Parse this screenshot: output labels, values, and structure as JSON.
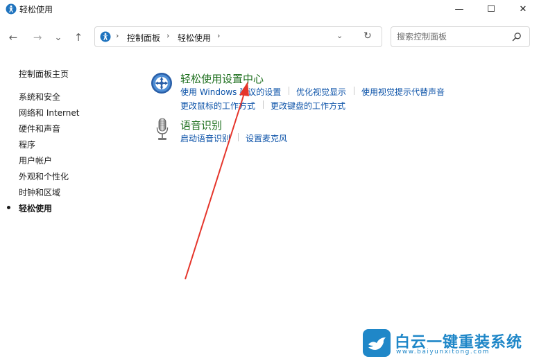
{
  "window": {
    "title": "轻松使用",
    "minimize_glyph": "—",
    "maximize_glyph": "☐",
    "close_glyph": "✕"
  },
  "nav": {
    "back_glyph": "←",
    "forward_glyph": "→",
    "recent_glyph": "⌄",
    "up_glyph": "↑",
    "breadcrumb": [
      "控制面板",
      "轻松使用"
    ],
    "dropdown_glyph": "⌄",
    "refresh_glyph": "↻"
  },
  "search": {
    "placeholder": "搜索控制面板"
  },
  "sidebar": {
    "items": [
      {
        "label": "控制面板主页",
        "current": false
      },
      {
        "label": "系统和安全",
        "current": false
      },
      {
        "label": "网络和 Internet",
        "current": false
      },
      {
        "label": "硬件和声音",
        "current": false
      },
      {
        "label": "程序",
        "current": false
      },
      {
        "label": "用户帐户",
        "current": false
      },
      {
        "label": "外观和个性化",
        "current": false
      },
      {
        "label": "时钟和区域",
        "current": false
      },
      {
        "label": "轻松使用",
        "current": true
      }
    ]
  },
  "main": {
    "sections": [
      {
        "title": "轻松使用设置中心",
        "icon": "ease-of-access-center-icon",
        "links": [
          "使用 Windows 建议的设置",
          "优化视觉显示",
          "使用视觉提示代替声音",
          "更改鼠标的工作方式",
          "更改键盘的工作方式"
        ]
      },
      {
        "title": "语音识别",
        "icon": "microphone-icon",
        "links": [
          "启动语音识别",
          "设置麦克风"
        ]
      }
    ]
  },
  "watermark": {
    "text": "白云一键重装系统",
    "url": "www.baiyunxitong.com"
  },
  "colors": {
    "section_title": "#1c6e1c",
    "link": "#0b52a8",
    "annotation_arrow": "#e5352b",
    "watermark": "#1f87c8"
  }
}
